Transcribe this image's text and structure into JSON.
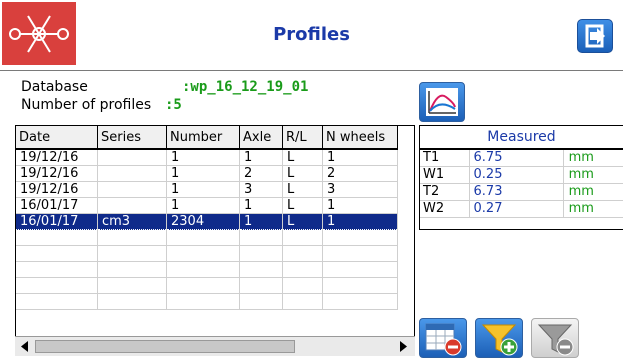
{
  "header": {
    "title": "Profiles",
    "logo_icon": "red-x-logo",
    "exit_icon": "exit-arrow-icon",
    "accent": "#1b3aa8"
  },
  "info": {
    "database_label": "Database",
    "database_value": ":wp_16_12_19_01",
    "profiles_label": "Number of profiles",
    "profiles_value": ":5",
    "chart_icon": "graph-curve-icon"
  },
  "table": {
    "columns": [
      "Date",
      "Series",
      "Number",
      "Axle",
      "R/L",
      "N wheels"
    ],
    "rows": [
      [
        "19/12/16",
        "",
        "1",
        "1",
        "L",
        "1"
      ],
      [
        "19/12/16",
        "",
        "1",
        "2",
        "L",
        "2"
      ],
      [
        "19/12/16",
        "",
        "1",
        "3",
        "L",
        "3"
      ],
      [
        "16/01/17",
        "",
        "1",
        "1",
        "L",
        "1"
      ],
      [
        "16/01/17",
        "cm3",
        "2304",
        "1",
        "L",
        "1"
      ]
    ],
    "selected_row": 4
  },
  "measured": {
    "title": "Measured",
    "rows": [
      {
        "name": "T1",
        "value": "6.75",
        "unit": "mm"
      },
      {
        "name": "W1",
        "value": "0.25",
        "unit": "mm"
      },
      {
        "name": "T2",
        "value": "6.73",
        "unit": "mm"
      },
      {
        "name": "W2",
        "value": "0.27",
        "unit": "mm"
      }
    ]
  },
  "buttons": {
    "delete_table_icon": "table-delete-icon",
    "filter_add_icon": "filter-add-icon",
    "filter_remove_icon": "filter-remove-icon"
  }
}
